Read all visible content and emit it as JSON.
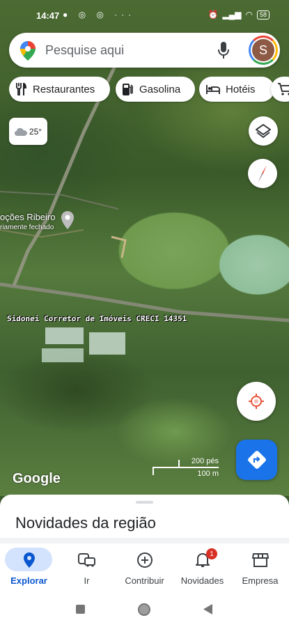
{
  "status_bar": {
    "time": "14:47",
    "battery": "58"
  },
  "search": {
    "placeholder": "Pesquise aqui",
    "avatar_initial": "S"
  },
  "chips": [
    {
      "label": "Restaurantes",
      "icon": "fork-knife-icon"
    },
    {
      "label": "Gasolina",
      "icon": "gas-pump-icon"
    },
    {
      "label": "Hotéis",
      "icon": "bed-icon"
    }
  ],
  "weather": {
    "temperature": "25°",
    "icon": "cloud-icon"
  },
  "map": {
    "place_name": "oções Ribeiro",
    "place_status": "riamente fechado",
    "watermark": "Sidonei Corretor de Imóveis CRECI 14351",
    "google_logo": "Google",
    "scale_imperial": "200 pés",
    "scale_metric": "100 m"
  },
  "sheet": {
    "title": "Novidades da região"
  },
  "bottom_nav": [
    {
      "label": "Explorar",
      "icon": "pin-icon",
      "active": true
    },
    {
      "label": "Ir",
      "icon": "commute-icon"
    },
    {
      "label": "Contribuir",
      "icon": "add-circle-icon"
    },
    {
      "label": "Novidades",
      "icon": "bell-icon",
      "badge": "1"
    },
    {
      "label": "Empresa",
      "icon": "store-icon"
    }
  ],
  "colors": {
    "accent": "#1a73e8",
    "nav_active_bg": "#d3e3fd",
    "badge": "#d93025"
  }
}
